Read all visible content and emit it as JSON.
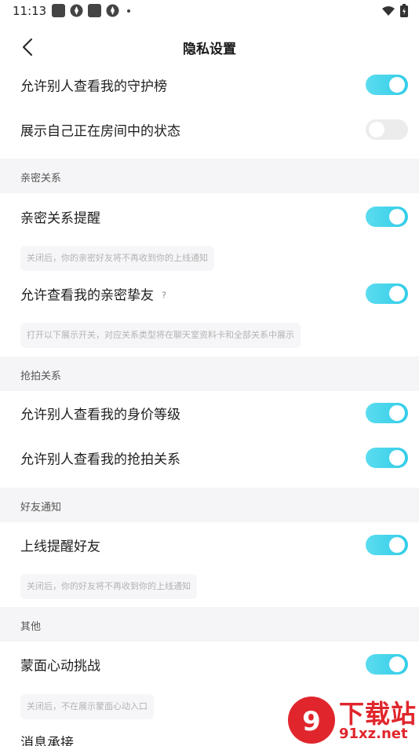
{
  "status_bar": {
    "time": "11:13"
  },
  "header": {
    "title": "隐私设置"
  },
  "rows": {
    "guard_list": {
      "label": "允许别人查看我的守护榜",
      "toggle": "on"
    },
    "room_status": {
      "label": "展示自己正在房间中的状态",
      "toggle": "off"
    },
    "intimacy_reminder": {
      "label": "亲密关系提醒",
      "toggle": "on"
    },
    "view_close_friends": {
      "label": "允许查看我的亲密挚友",
      "toggle": "on"
    },
    "worth_level": {
      "label": "允许别人查看我的身价等级",
      "toggle": "on"
    },
    "grab_relation": {
      "label": "允许别人查看我的抢拍关系",
      "toggle": "on"
    },
    "online_remind_friends": {
      "label": "上线提醒好友",
      "toggle": "on"
    },
    "mask_challenge": {
      "label": "蒙面心动挑战",
      "toggle": "on"
    },
    "message_receive": {
      "label": "消息承接"
    }
  },
  "sections": {
    "intimacy": "亲密关系",
    "grab": "抢拍关系",
    "friend_notify": "好友通知",
    "other": "其他"
  },
  "hints": {
    "intimacy_off": "关闭后，你的亲密好友将不再收到你的上线通知",
    "close_friends": "打开以下展示开关，对应关系类型将在聊天室资料卡和全部关系中展示",
    "friend_off": "关闭后，你的好友将不再收到你的上线通知",
    "mask_off": "关闭后，不在展示蒙面心动入口"
  },
  "help_mark": "?",
  "watermark": {
    "text": "下载站",
    "sub": "91xz.net"
  },
  "colors": {
    "toggle_on": "#33cde8",
    "toggle_off": "#ececec",
    "section_bg": "#f5f5f7",
    "watermark": "#e0262c"
  }
}
